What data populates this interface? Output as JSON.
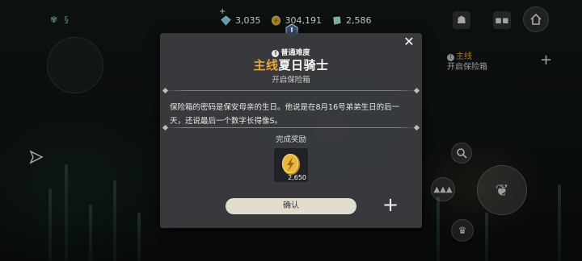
{
  "currency": {
    "plus_label": "+",
    "diamonds": "3,035",
    "gold": "304,191",
    "gems": "2,586"
  },
  "side_quest": {
    "main_label": "主线",
    "task": "开启保险箱"
  },
  "modal": {
    "difficulty": "普通难度",
    "title_main": "主线",
    "title_name": "夏日骑士",
    "subtitle": "开启保险箱",
    "description": "保险箱的密码是保安母亲的生日。他说是在8月16号弟弟生日的后一天，还说最后一个数字长得像S。",
    "reward_label": "完成奖励",
    "reward_count": "2,650",
    "confirm_label": "确认",
    "close_label": "✕",
    "add_label": "+"
  },
  "colors": {
    "accent_gold": "#e8a53c",
    "modal_bg": "#3a3c3f",
    "confirm_bg": "#e3ddd0"
  },
  "icons": [
    "diamond-icon",
    "gold-coin-icon",
    "gem-icon",
    "close-icon",
    "plus-icon",
    "shop-icon",
    "home-icon",
    "zoom-icon",
    "navigate-arrow-icon",
    "quest-emblem-icon"
  ]
}
